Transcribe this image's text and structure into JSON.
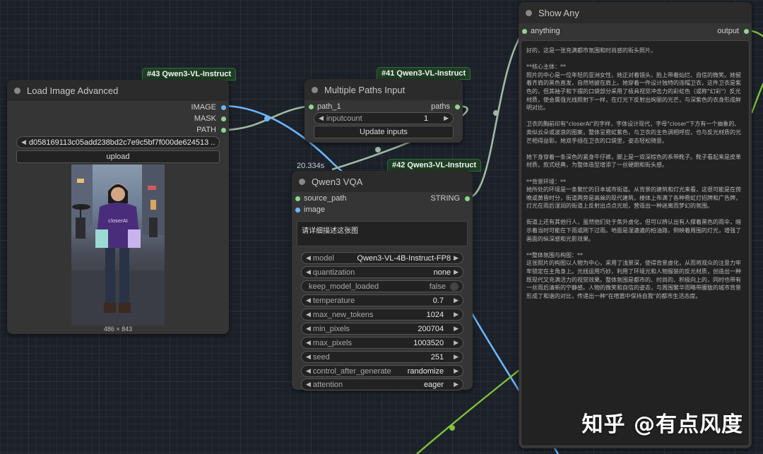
{
  "colors": {
    "badge_bg": "#1f3e24",
    "node_bg": "#353535",
    "wire_blue": "#6ab7ff",
    "wire_grey": "#9fb8a4",
    "wire_green": "#7ec43a"
  },
  "node43": {
    "badge": "#43 Qwen3-VL-Instruct",
    "title": "Load Image Advanced",
    "outputs": [
      "IMAGE",
      "MASK",
      "PATH"
    ],
    "image_select": "d058169113c05add238bd2c7e9c5bf7f000de624513 ...",
    "upload_label": "upload",
    "image_caption": "486 × 843",
    "image_logo": "closerAI"
  },
  "node41": {
    "badge": "#41 Qwen3-VL-Instruct",
    "title": "Multiple Paths Input",
    "input": "path_1",
    "output": "paths",
    "inputcount_label": "inputcount",
    "inputcount_value": "1",
    "update_label": "Update inputs"
  },
  "node42": {
    "timing": "20.334s",
    "badge": "#42 Qwen3-VL-Instruct",
    "title": "Qwen3 VQA",
    "inputs": [
      "source_path",
      "image"
    ],
    "output": "STRING",
    "prompt": "请详细描述这张图",
    "widgets": [
      {
        "label": "model",
        "value": "Qwen3-VL-4B-Instruct-FP8"
      },
      {
        "label": "quantization",
        "value": "none"
      },
      {
        "label": "keep_model_loaded",
        "value": "false"
      },
      {
        "label": "temperature",
        "value": "0.7"
      },
      {
        "label": "max_new_tokens",
        "value": "1024"
      },
      {
        "label": "min_pixels",
        "value": "200704"
      },
      {
        "label": "max_pixels",
        "value": "1003520"
      },
      {
        "label": "seed",
        "value": "251"
      },
      {
        "label": "control_after_generate",
        "value": "randomize"
      },
      {
        "label": "attention",
        "value": "eager"
      }
    ]
  },
  "node_show": {
    "title": "Show Any",
    "input": "anything",
    "output": "output",
    "text": "好的，这是一张充满都市氛围和时尚感的街头照片。\n\n**核心主体：**\n照片的中心是一位年轻的亚洲女性，她正对着镜头，脸上带着灿烂、自信的微笑。她留着齐肩的黑色直发，自然地披在肩上。她穿着一件设计独特的连帽卫衣，这件卫衣是紫色的，但其袖子和下摆的口袋部分采用了极具视觉冲击力的彩虹色（或称\"幻彩\"）反光材质，使会属强光线照射下一样，在灯光下反射出绚丽的光芒，与深紫色的衣身形成鲜明对比。\n\n卫衣的胸前印有\"closerAI\"的字样，字体设计现代，字母\"closer\"下方有一个抽象的、类似云朵或波浪的图案，整体呈霓虹紫色，与卫衣的主色调相呼应，也与反光材质的光芒相得益彰。她双手插在卫衣的口袋里，姿态轻松随意。\n\n她下身穿着一条深色的紧身牛仔裤，脚上是一双深棕色的系带靴子。靴子看起来是皮革材质，款式经典，为整体造型增添了一丝硬朗和街头感。\n\n**背景环境：**\n她所处的环境是一条繁忙的日本城市街道。从背景的建筑和灯光来看，这很可能是在傍晚或黄昏时分，街道两旁是高耸的现代建筑，楼体上布满了各种霓虹灯招牌和广告牌，灯光在雨后湿润的街道上反射出点点光斑，营造出一种迷离而梦幻的氛围。\n\n街道上还有其他行人，虽然他们处于焦外虚化，但可以辨认出有人撑着黑色的雨伞，暗示着当时可能在下雨或刚下过雨。地面是湿漉漉的柏油路，倒映着周围的灯光，增强了画面的纵深感和光影效果。\n\n**整体氛围与构图：**\n这张照片的构图以人物为中心，采用了浅景深，使得背景虚化，从而将观众的注意力牢牢锁定在主角身上。光线运用巧妙，利用了环境光和人物服装的反光材质，创造出一种既现代又充满活力的视觉效果。整体氛围是都市的、时尚的、积极向上的，同时也带有一丝雨后清新的宁静感。人物的微笑和自信的姿态，与周围繁华而略带朦胧的城市背景形成了和谐的对比，传递出一种\"在喧嚣中保持自我\"的都市生活态度。"
  },
  "watermark": "知乎 @有点风度"
}
